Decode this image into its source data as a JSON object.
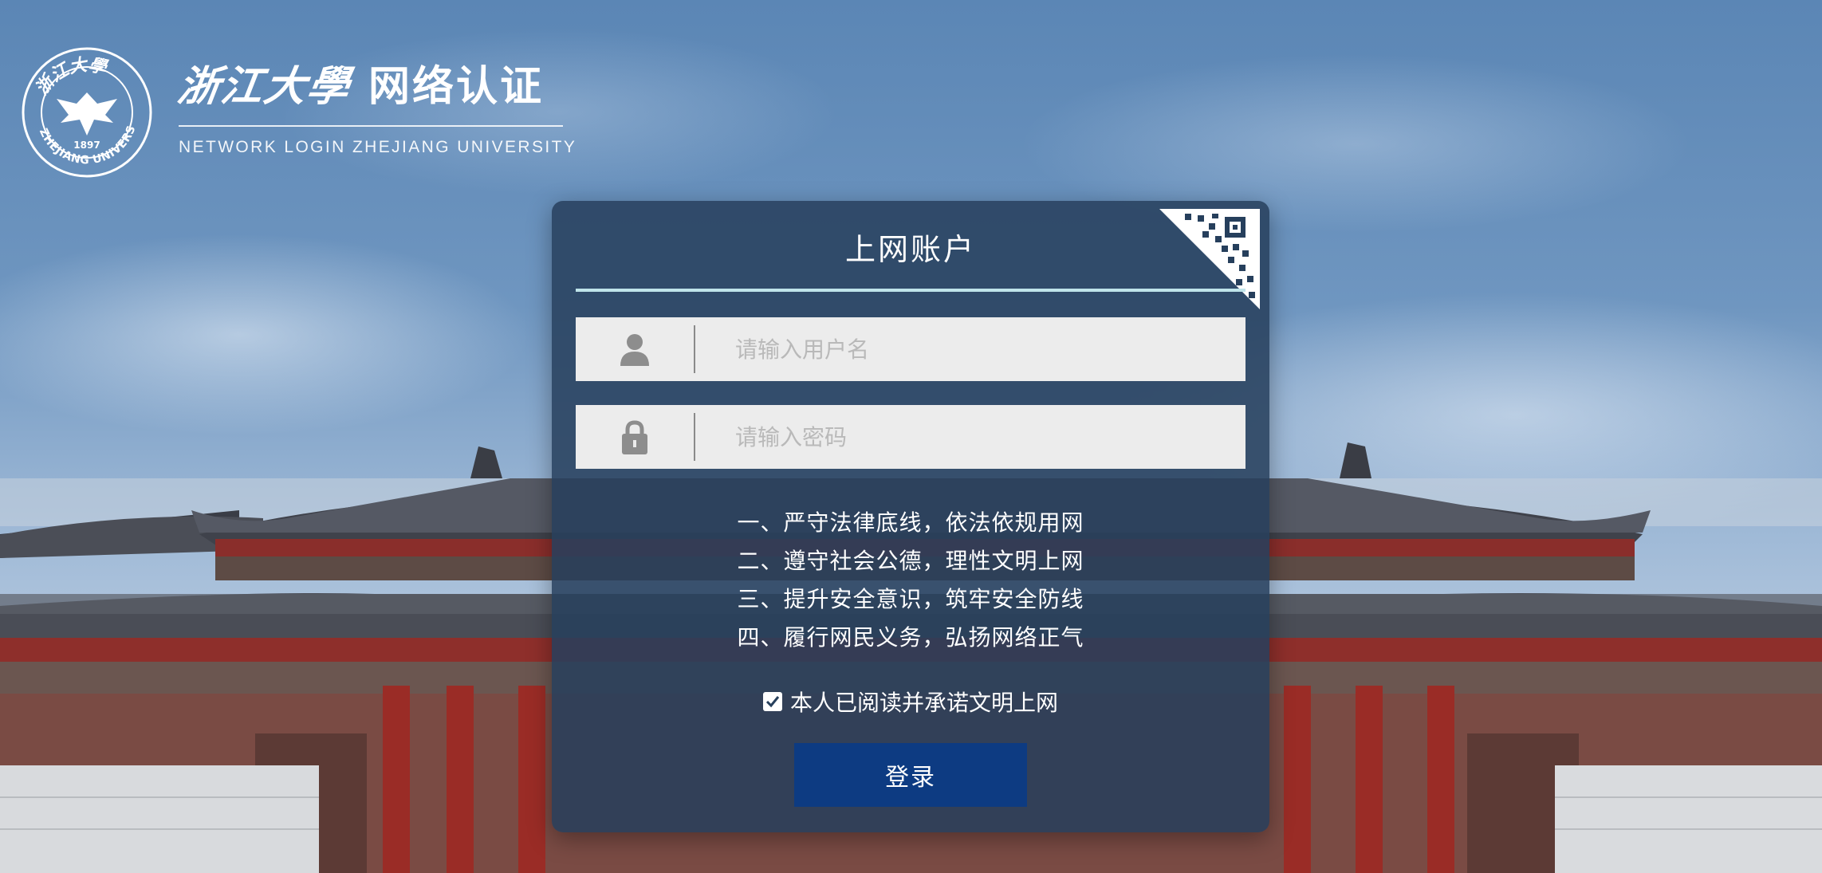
{
  "header": {
    "calligraphy_name": "浙江大學",
    "title": "网络认证",
    "subtitle": "NETWORK LOGIN ZHEJIANG UNIVERSITY",
    "seal": {
      "year": "1897",
      "ring_text": "ZHEJIANG UNIVERSITY"
    }
  },
  "login": {
    "title": "上网账户",
    "username": {
      "placeholder": "请输入用户名",
      "value": "",
      "icon": "user-icon"
    },
    "password": {
      "placeholder": "请输入密码",
      "value": "",
      "icon": "lock-icon"
    },
    "qr_toggle_icon": "qr-code-icon",
    "rules": [
      "一、严守法律底线，依法依规用网",
      "二、遵守社会公德，理性文明上网",
      "三、提升安全意识，筑牢安全防线",
      "四、履行网民义务，弘扬网络正气"
    ],
    "agreement": {
      "label": "本人已阅读并承诺文明上网",
      "checked": true
    },
    "submit_label": "登录"
  },
  "colors": {
    "panel_bg": "#263f5c",
    "accent_rule": "#bfe4ea",
    "button_bg": "#0d3b82",
    "input_bg": "#ececec"
  }
}
